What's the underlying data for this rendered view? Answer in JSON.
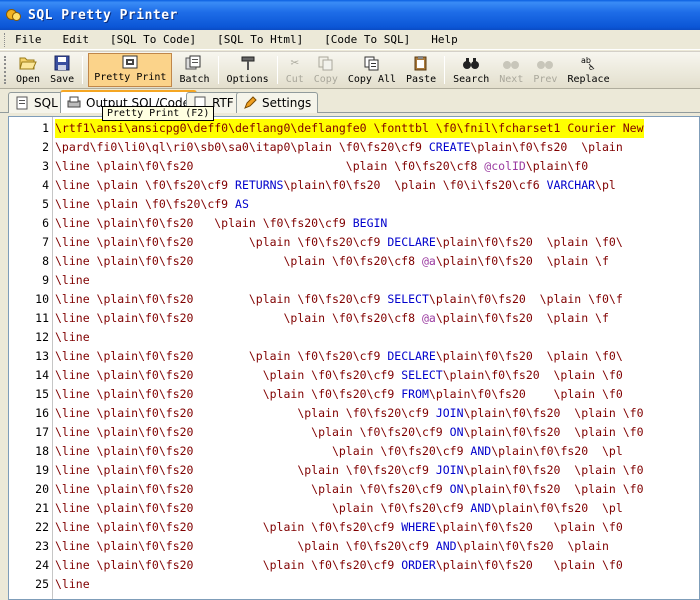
{
  "window": {
    "title": "SQL Pretty Printer"
  },
  "menu": [
    {
      "key": "file",
      "label": "File"
    },
    {
      "key": "edit",
      "label": "Edit"
    },
    {
      "key": "sql_to_code",
      "label": "[SQL To Code]"
    },
    {
      "key": "sql_to_html",
      "label": "[SQL To Html]"
    },
    {
      "key": "code_to_sql",
      "label": "[Code To SQL]"
    },
    {
      "key": "help",
      "label": "Help"
    }
  ],
  "toolbar": {
    "open": "Open",
    "save": "Save",
    "pretty_print": "Pretty Print",
    "batch": "Batch",
    "options": "Options",
    "cut": "Cut",
    "copy": "Copy",
    "copy_all": "Copy All",
    "paste": "Paste",
    "search": "Search",
    "next": "Next",
    "prev": "Prev",
    "replace": "Replace"
  },
  "tabs": {
    "sql": "SQL",
    "output": "Output SQL/Code",
    "rtf": "RTF",
    "settings": "Settings"
  },
  "tooltip": "Pretty Print (F2)",
  "lines": [
    {
      "n": "1",
      "parts": [
        [
          "t",
          "\\rtf1\\ansi\\ansicpg0\\deff0\\deflang0\\deflangfe0 \\fonttbl \\f0\\fnil\\fcharset1 Courier New"
        ]
      ]
    },
    {
      "n": "2",
      "parts": [
        [
          "t",
          "\\pard\\fi0\\li0\\ql\\ri0\\sb0\\sa0\\itap0\\plain \\f0\\fs20\\cf9 "
        ],
        [
          "k",
          "CREATE"
        ],
        [
          "t",
          "\\plain\\f0\\fs20  \\plain"
        ]
      ]
    },
    {
      "n": "3",
      "parts": [
        [
          "t",
          "\\line \\plain\\f0\\fs20                      \\plain \\f0\\fs20\\cf8 "
        ],
        [
          "v",
          "@colID"
        ],
        [
          "t",
          "\\plain\\f0"
        ]
      ]
    },
    {
      "n": "4",
      "parts": [
        [
          "t",
          "\\line \\plain \\f0\\fs20\\cf9 "
        ],
        [
          "k",
          "RETURNS"
        ],
        [
          "t",
          "\\plain\\f0\\fs20  \\plain \\f0\\i\\fs20\\cf6 "
        ],
        [
          "k",
          "VARCHAR"
        ],
        [
          "t",
          "\\pl"
        ]
      ]
    },
    {
      "n": "5",
      "parts": [
        [
          "t",
          "\\line \\plain \\f0\\fs20\\cf9 "
        ],
        [
          "k",
          "AS"
        ]
      ]
    },
    {
      "n": "6",
      "parts": [
        [
          "t",
          "\\line \\plain\\f0\\fs20   \\plain \\f0\\fs20\\cf9 "
        ],
        [
          "k",
          "BEGIN"
        ]
      ]
    },
    {
      "n": "7",
      "parts": [
        [
          "t",
          "\\line \\plain\\f0\\fs20        \\plain \\f0\\fs20\\cf9 "
        ],
        [
          "k",
          "DECLARE"
        ],
        [
          "t",
          "\\plain\\f0\\fs20  \\plain \\f0\\"
        ]
      ]
    },
    {
      "n": "8",
      "parts": [
        [
          "t",
          "\\line \\plain\\f0\\fs20             \\plain \\f0\\fs20\\cf8 "
        ],
        [
          "v",
          "@a"
        ],
        [
          "t",
          "\\plain\\f0\\fs20  \\plain \\f"
        ]
      ]
    },
    {
      "n": "9",
      "parts": [
        [
          "t",
          "\\line"
        ]
      ]
    },
    {
      "n": "10",
      "parts": [
        [
          "t",
          "\\line \\plain\\f0\\fs20        \\plain \\f0\\fs20\\cf9 "
        ],
        [
          "k",
          "SELECT"
        ],
        [
          "t",
          "\\plain\\f0\\fs20  \\plain \\f0\\f"
        ]
      ]
    },
    {
      "n": "11",
      "parts": [
        [
          "t",
          "\\line \\plain\\f0\\fs20             \\plain \\f0\\fs20\\cf8 "
        ],
        [
          "v",
          "@a"
        ],
        [
          "t",
          "\\plain\\f0\\fs20  \\plain \\f"
        ]
      ]
    },
    {
      "n": "12",
      "parts": [
        [
          "t",
          "\\line"
        ]
      ]
    },
    {
      "n": "13",
      "parts": [
        [
          "t",
          "\\line \\plain\\f0\\fs20        \\plain \\f0\\fs20\\cf9 "
        ],
        [
          "k",
          "DECLARE"
        ],
        [
          "t",
          "\\plain\\f0\\fs20  \\plain \\f0\\"
        ]
      ]
    },
    {
      "n": "14",
      "parts": [
        [
          "t",
          "\\line \\plain\\f0\\fs20          \\plain \\f0\\fs20\\cf9 "
        ],
        [
          "k",
          "SELECT"
        ],
        [
          "t",
          "\\plain\\f0\\fs20  \\plain \\f0"
        ]
      ]
    },
    {
      "n": "15",
      "parts": [
        [
          "t",
          "\\line \\plain\\f0\\fs20          \\plain \\f0\\fs20\\cf9 "
        ],
        [
          "k",
          "FROM"
        ],
        [
          "t",
          "\\plain\\f0\\fs20    \\plain \\f0"
        ]
      ]
    },
    {
      "n": "16",
      "parts": [
        [
          "t",
          "\\line \\plain\\f0\\fs20               \\plain \\f0\\fs20\\cf9 "
        ],
        [
          "k",
          "JOIN"
        ],
        [
          "t",
          "\\plain\\f0\\fs20  \\plain \\f0"
        ]
      ]
    },
    {
      "n": "17",
      "parts": [
        [
          "t",
          "\\line \\plain\\f0\\fs20                 \\plain \\f0\\fs20\\cf9 "
        ],
        [
          "k",
          "ON"
        ],
        [
          "t",
          "\\plain\\f0\\fs20  \\plain \\f0"
        ]
      ]
    },
    {
      "n": "18",
      "parts": [
        [
          "t",
          "\\line \\plain\\f0\\fs20                    \\plain \\f0\\fs20\\cf9 "
        ],
        [
          "k",
          "AND"
        ],
        [
          "t",
          "\\plain\\f0\\fs20  \\pl"
        ]
      ]
    },
    {
      "n": "19",
      "parts": [
        [
          "t",
          "\\line \\plain\\f0\\fs20               \\plain \\f0\\fs20\\cf9 "
        ],
        [
          "k",
          "JOIN"
        ],
        [
          "t",
          "\\plain\\f0\\fs20  \\plain \\f0"
        ]
      ]
    },
    {
      "n": "20",
      "parts": [
        [
          "t",
          "\\line \\plain\\f0\\fs20                 \\plain \\f0\\fs20\\cf9 "
        ],
        [
          "k",
          "ON"
        ],
        [
          "t",
          "\\plain\\f0\\fs20  \\plain \\f0"
        ]
      ]
    },
    {
      "n": "21",
      "parts": [
        [
          "t",
          "\\line \\plain\\f0\\fs20                    \\plain \\f0\\fs20\\cf9 "
        ],
        [
          "k",
          "AND"
        ],
        [
          "t",
          "\\plain\\f0\\fs20  \\pl"
        ]
      ]
    },
    {
      "n": "22",
      "parts": [
        [
          "t",
          "\\line \\plain\\f0\\fs20          \\plain \\f0\\fs20\\cf9 "
        ],
        [
          "k",
          "WHERE"
        ],
        [
          "t",
          "\\plain\\f0\\fs20   \\plain \\f0"
        ]
      ]
    },
    {
      "n": "23",
      "parts": [
        [
          "t",
          "\\line \\plain\\f0\\fs20               \\plain \\f0\\fs20\\cf9 "
        ],
        [
          "k",
          "AND"
        ],
        [
          "t",
          "\\plain\\f0\\fs20  \\plain"
        ]
      ]
    },
    {
      "n": "24",
      "parts": [
        [
          "t",
          "\\line \\plain\\f0\\fs20          \\plain \\f0\\fs20\\cf9 "
        ],
        [
          "k",
          "ORDER"
        ],
        [
          "t",
          "\\plain\\f0\\fs20   \\plain \\f0"
        ]
      ]
    },
    {
      "n": "25",
      "parts": [
        [
          "t",
          "\\line"
        ]
      ]
    }
  ],
  "colors": {
    "keyword": "#0000cc",
    "variable": "#9a3aa0",
    "text": "#800000",
    "highlight": "#ffff00"
  }
}
